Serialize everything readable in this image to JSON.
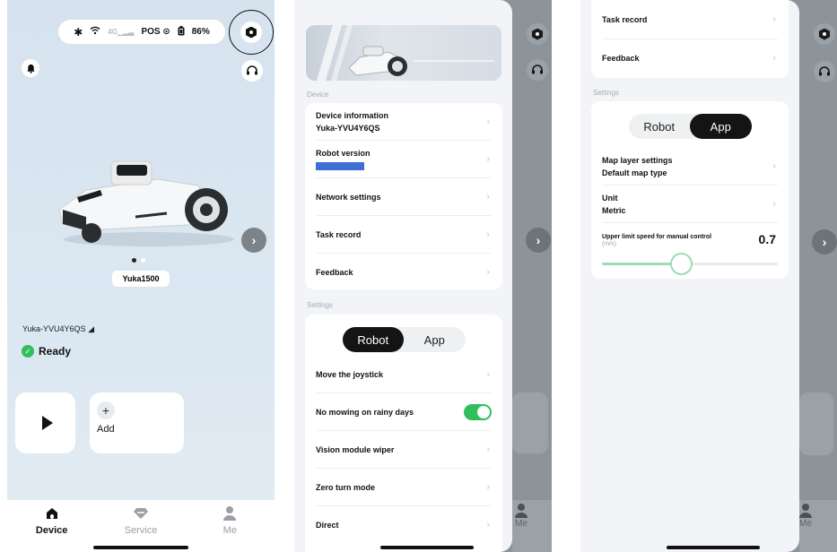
{
  "screen1": {
    "status": {
      "bluetooth": "✱",
      "battery_percent": "86%",
      "signal_label": "4G",
      "pos_label": "POS"
    },
    "device_model": "Yuka1500",
    "device_name": "Yuka-YVU4Y6QS",
    "device_name_arrow": "◢",
    "status_text": "Ready",
    "add_label": "Add",
    "add_symbol": "+",
    "tabs": [
      {
        "label": "Device",
        "icon": "home-icon"
      },
      {
        "label": "Service",
        "icon": "diamond-icon"
      },
      {
        "label": "Me",
        "icon": "person-icon"
      }
    ]
  },
  "screen2": {
    "device_section": "Device",
    "device_items": [
      {
        "label": "Device information",
        "sub": "Yuka-YVU4Y6QS"
      },
      {
        "label": "Robot version",
        "sub": ""
      },
      {
        "label": "Network settings"
      },
      {
        "label": "Task record"
      },
      {
        "label": "Feedback"
      }
    ],
    "settings_section": "Settings",
    "segment": {
      "robot": "Robot",
      "app": "App",
      "selected": "Robot"
    },
    "settings_items": [
      {
        "label": "Move the joystick"
      },
      {
        "label": "No mowing on rainy days",
        "toggle": true
      },
      {
        "label": "Vision module wiper"
      },
      {
        "label": "Zero turn mode"
      },
      {
        "label": "Direct"
      }
    ],
    "side_tab_label": "Me"
  },
  "screen3": {
    "top_items": [
      {
        "label": "Task record"
      },
      {
        "label": "Feedback"
      }
    ],
    "settings_section": "Settings",
    "segment": {
      "robot": "Robot",
      "app": "App",
      "selected": "App"
    },
    "app_items": [
      {
        "label": "Map layer settings",
        "sub": "Default map type"
      },
      {
        "label": "Unit",
        "sub": "Metric"
      }
    ],
    "speed": {
      "label": "Upper limit speed for manual control",
      "unit": "(m/s)",
      "value": "0.7",
      "slider_fraction": 0.45
    },
    "side_tab_label": "Me"
  },
  "chevron": "›",
  "colors": {
    "accent_green": "#2fbf5b",
    "blue_placeholder": "#3e6fd3",
    "slider_green": "#9cdcb4"
  }
}
